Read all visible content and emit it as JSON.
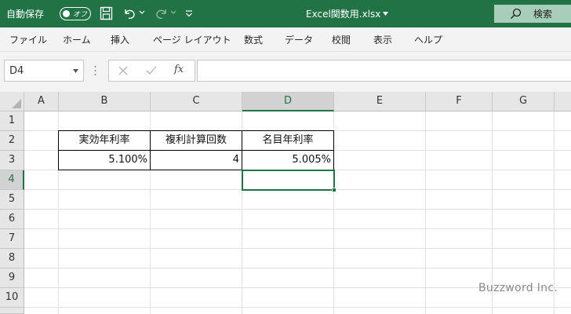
{
  "titlebar": {
    "autosave_label": "自動保存",
    "autosave_state": "オフ",
    "document_title": "Excel関数用.xlsx",
    "search_label": "検索",
    "bg_color": "#217346"
  },
  "ribbon": {
    "tabs": [
      "ファイル",
      "ホーム",
      "挿入",
      "ページ レイアウト",
      "数式",
      "データ",
      "校閲",
      "表示",
      "ヘルプ"
    ]
  },
  "formula_bar": {
    "name_box": "D4",
    "fx_label": "fx",
    "formula": ""
  },
  "sheet": {
    "columns": [
      "A",
      "B",
      "C",
      "D",
      "E",
      "F",
      "G"
    ],
    "rows": [
      "1",
      "2",
      "3",
      "4",
      "5",
      "6",
      "7",
      "8",
      "9",
      "10"
    ],
    "selected_cell": "D4",
    "headers": [
      "実効年利率",
      "複利計算回数",
      "名目年利率"
    ],
    "values": [
      "5.100%",
      "4",
      "5.005%"
    ]
  },
  "watermark": "Buzzword Inc.",
  "accent_color": "#217346"
}
